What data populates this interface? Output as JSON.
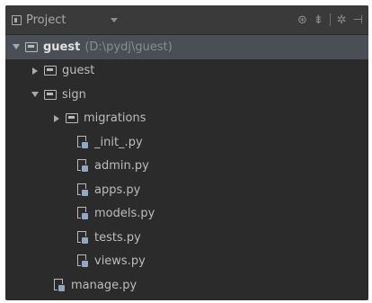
{
  "header": {
    "title": "Project",
    "tool_icons": [
      "target-icon",
      "collapse-icon",
      "gear-icon",
      "hide-icon"
    ]
  },
  "tree": [
    {
      "name": "guest",
      "path": "(D:\\pydj\\guest)",
      "type": "folder",
      "indent": 0,
      "expanded": true,
      "selected": true,
      "bold": true
    },
    {
      "name": "guest",
      "type": "folder",
      "indent": 1,
      "expanded": false
    },
    {
      "name": "sign",
      "type": "folder",
      "indent": 1,
      "expanded": true
    },
    {
      "name": "migrations",
      "type": "folder",
      "indent": 2,
      "expanded": false
    },
    {
      "name": "_init_.py",
      "type": "python-file",
      "indent": 2
    },
    {
      "name": "admin.py",
      "type": "python-file",
      "indent": 2
    },
    {
      "name": "apps.py",
      "type": "python-file",
      "indent": 2
    },
    {
      "name": "models.py",
      "type": "python-file",
      "indent": 2
    },
    {
      "name": "tests.py",
      "type": "python-file",
      "indent": 2
    },
    {
      "name": "views.py",
      "type": "python-file",
      "indent": 2
    },
    {
      "name": "manage.py",
      "type": "python-file",
      "indent": 1
    }
  ],
  "colors": {
    "panel_bg": "#2b2b2b",
    "header_bg": "#3a3a3a",
    "selected_bg": "#4a4f55",
    "text": "#bcbcbc"
  }
}
